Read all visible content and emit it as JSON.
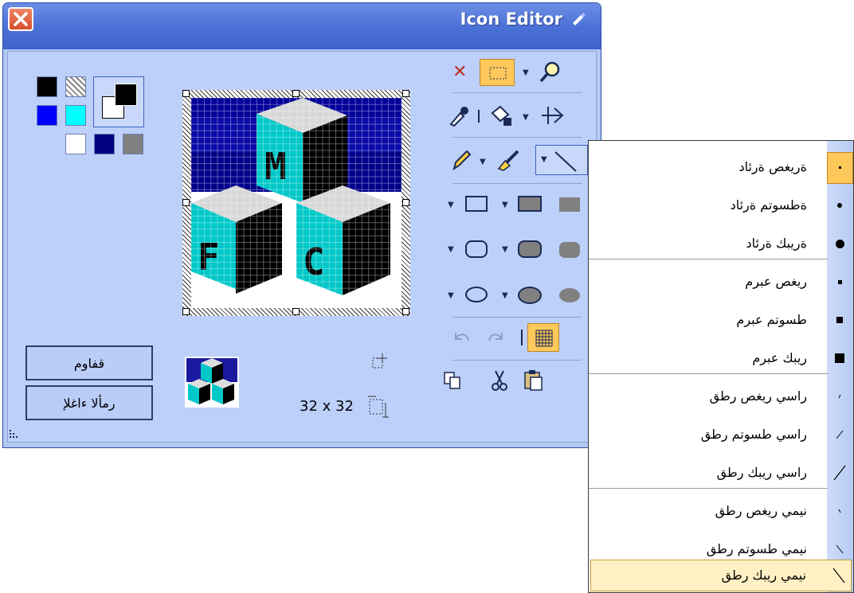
{
  "window": {
    "title": "Icon Editor",
    "close_label": "×"
  },
  "palette": {
    "swatches": [
      "#000000",
      "hatched-transparent",
      "#0000ff",
      "#00ffff",
      "#ffffff",
      "#000080",
      "#808080"
    ],
    "foreground": "#000000",
    "background": "#ffffff"
  },
  "canvas": {
    "size_text": "32 x 32"
  },
  "buttons": {
    "ok_label": "قفاوم",
    "cancel_label": "رمألا ءاغلإ"
  },
  "toolbar": {
    "clear_icon": "✕",
    "select_icon": "selection-icon",
    "zoom_icon": "magnifier-icon",
    "picker_icon": "eyedropper-icon",
    "fill_icon": "fill-bucket-icon",
    "flip_icon": "flip-icon",
    "pencil_icon": "pencil-icon",
    "brush_icon": "brush-icon",
    "line_icon": "line-icon"
  },
  "menu": {
    "items": [
      {
        "label": "ةريغص ةرئاد",
        "icon": "tiny-dot"
      },
      {
        "label": "ةطسوتم ةرئاد",
        "icon": "small-dot"
      },
      {
        "label": "ةريبك ةرئاد",
        "icon": "big-dot"
      },
      {
        "label": "ريغص عبرم",
        "icon": "tiny-square"
      },
      {
        "label": "طسوتم عبرم",
        "icon": "small-square"
      },
      {
        "label": "ريبك عبرم",
        "icon": "big-square"
      },
      {
        "label": "راسي ريغص رطق",
        "icon": "diag-left-small"
      },
      {
        "label": "راسي طسوتم رطق",
        "icon": "diag-left-medium"
      },
      {
        "label": "راسي ريبك رطق",
        "icon": "diag-left-large"
      },
      {
        "label": "نيمي ريغص رطق",
        "icon": "diag-right-small"
      },
      {
        "label": "نيمي طسوتم رطق",
        "icon": "diag-right-medium"
      },
      {
        "label": "نيمي ريبك رطق",
        "icon": "diag-right-large"
      }
    ],
    "selected_index": 11
  },
  "colors": {
    "accent": "#4a6fd5",
    "highlight": "#ffc85a"
  }
}
